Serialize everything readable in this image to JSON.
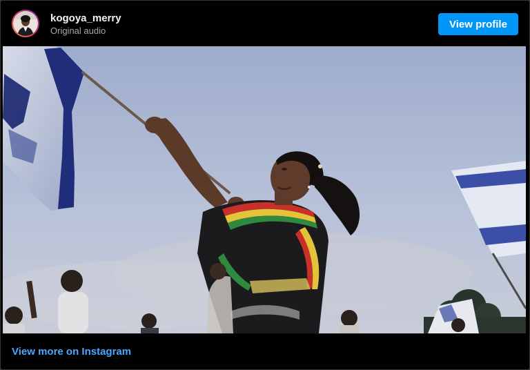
{
  "header": {
    "username": "kogoya_merry",
    "subtitle": "Original audio",
    "view_profile_label": "View profile"
  },
  "media": {
    "type": "video-frame",
    "description_icon": "video-frame"
  },
  "footer": {
    "view_more_label": "View more on Instagram"
  },
  "colors": {
    "accent": "#0095f6",
    "link": "#4aa8ff",
    "background": "#000000",
    "username_text": "#f5f5f5",
    "secondary_text": "#a8a8a8"
  }
}
